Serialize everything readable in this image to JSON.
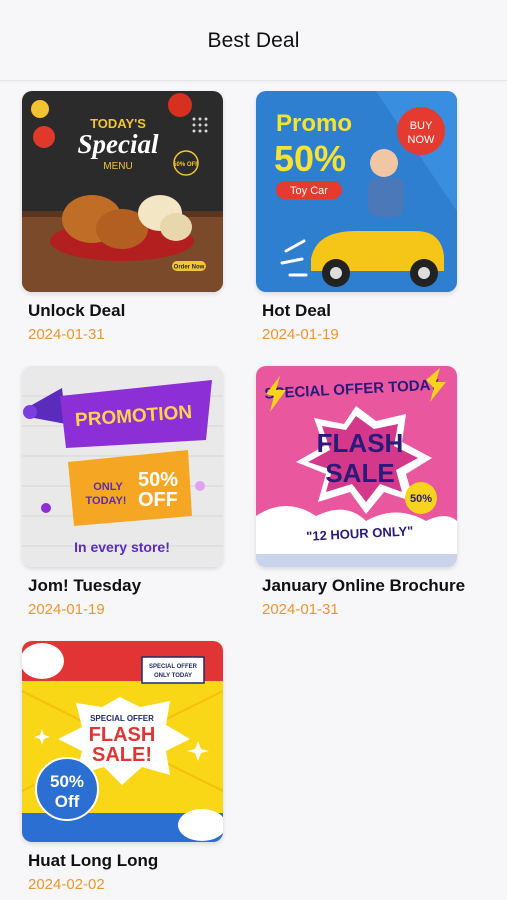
{
  "header": {
    "title": "Best Deal"
  },
  "colors": {
    "date": "#f0942d",
    "background": "#f7f7f9"
  },
  "deals": [
    {
      "title": "Unlock Deal",
      "date": "2024-01-31",
      "image": {
        "line1": "TODAY'S",
        "line2": "Special",
        "line3": "MENU",
        "badge": "50% OFF",
        "button": "Order Now"
      }
    },
    {
      "title": "Hot Deal",
      "date": "2024-01-19",
      "image": {
        "line1": "Promo",
        "line2": "50%",
        "tag": "Toy Car",
        "badge1": "BUY",
        "badge2": "NOW"
      }
    },
    {
      "title": "Jom! Tuesday",
      "date": "2024-01-19",
      "image": {
        "banner": "PROMOTION",
        "only": "ONLY",
        "today": "TODAY!",
        "pct": "50%",
        "off": "OFF",
        "footer": "In every store!"
      }
    },
    {
      "title": "January Online Brochure",
      "date": "2024-01-31",
      "image": {
        "top": "SPECIAL OFFER TODAY",
        "flash": "FLASH",
        "sale": "SALE",
        "pct": "50%",
        "hours": "\"12 HOUR ONLY\""
      }
    },
    {
      "title": "Huat Long Long",
      "date": "2024-02-02",
      "image": {
        "corner1": "SPECIAL OFFER",
        "corner2": "ONLY TODAY",
        "special": "SPECIAL OFFER",
        "flash": "FLASH",
        "sale": "SALE!",
        "pct": "50%",
        "off": "Off"
      }
    }
  ]
}
